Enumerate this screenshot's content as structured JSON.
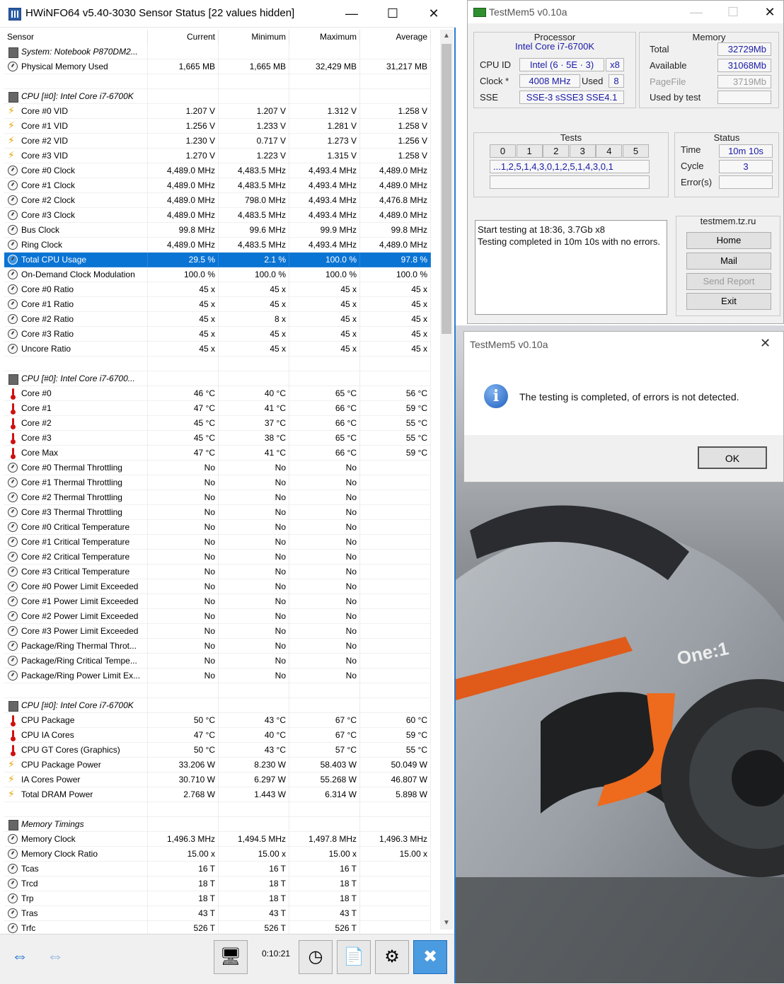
{
  "hwinfo": {
    "title": "HWiNFO64 v5.40-3030 Sensor Status [22 values hidden]",
    "columns": [
      "Sensor",
      "Current",
      "Minimum",
      "Maximum",
      "Average"
    ],
    "rows": [
      {
        "type": "group",
        "icon": "chip",
        "name": "System: Notebook P870DM2...",
        "cur": "",
        "min": "",
        "max": "",
        "avg": ""
      },
      {
        "type": "data",
        "icon": "gauge",
        "name": "Physical Memory Used",
        "cur": "1,665 MB",
        "min": "1,665 MB",
        "max": "32,429 MB",
        "avg": "31,217 MB"
      },
      {
        "type": "blank"
      },
      {
        "type": "group",
        "icon": "chip",
        "name": "CPU [#0]: Intel Core i7-6700K",
        "cur": "",
        "min": "",
        "max": "",
        "avg": ""
      },
      {
        "type": "data",
        "icon": "bolt",
        "name": "Core #0 VID",
        "cur": "1.207 V",
        "min": "1.207 V",
        "max": "1.312 V",
        "avg": "1.258 V"
      },
      {
        "type": "data",
        "icon": "bolt",
        "name": "Core #1 VID",
        "cur": "1.256 V",
        "min": "1.233 V",
        "max": "1.281 V",
        "avg": "1.258 V"
      },
      {
        "type": "data",
        "icon": "bolt",
        "name": "Core #2 VID",
        "cur": "1.230 V",
        "min": "0.717 V",
        "max": "1.273 V",
        "avg": "1.256 V"
      },
      {
        "type": "data",
        "icon": "bolt",
        "name": "Core #3 VID",
        "cur": "1.270 V",
        "min": "1.223 V",
        "max": "1.315 V",
        "avg": "1.258 V"
      },
      {
        "type": "data",
        "icon": "gauge",
        "name": "Core #0 Clock",
        "cur": "4,489.0 MHz",
        "min": "4,483.5 MHz",
        "max": "4,493.4 MHz",
        "avg": "4,489.0 MHz"
      },
      {
        "type": "data",
        "icon": "gauge",
        "name": "Core #1 Clock",
        "cur": "4,489.0 MHz",
        "min": "4,483.5 MHz",
        "max": "4,493.4 MHz",
        "avg": "4,489.0 MHz"
      },
      {
        "type": "data",
        "icon": "gauge",
        "name": "Core #2 Clock",
        "cur": "4,489.0 MHz",
        "min": "798.0 MHz",
        "max": "4,493.4 MHz",
        "avg": "4,476.8 MHz"
      },
      {
        "type": "data",
        "icon": "gauge",
        "name": "Core #3 Clock",
        "cur": "4,489.0 MHz",
        "min": "4,483.5 MHz",
        "max": "4,493.4 MHz",
        "avg": "4,489.0 MHz"
      },
      {
        "type": "data",
        "icon": "gauge",
        "name": "Bus Clock",
        "cur": "99.8 MHz",
        "min": "99.6 MHz",
        "max": "99.9 MHz",
        "avg": "99.8 MHz"
      },
      {
        "type": "data",
        "icon": "gauge",
        "name": "Ring Clock",
        "cur": "4,489.0 MHz",
        "min": "4,483.5 MHz",
        "max": "4,493.4 MHz",
        "avg": "4,489.0 MHz"
      },
      {
        "type": "data",
        "icon": "gauge",
        "name": "Total CPU Usage",
        "cur": "29.5 %",
        "min": "2.1 %",
        "max": "100.0 %",
        "avg": "97.8 %",
        "selected": true
      },
      {
        "type": "data",
        "icon": "gauge",
        "name": "On-Demand Clock Modulation",
        "cur": "100.0 %",
        "min": "100.0 %",
        "max": "100.0 %",
        "avg": "100.0 %"
      },
      {
        "type": "data",
        "icon": "gauge",
        "name": "Core #0 Ratio",
        "cur": "45 x",
        "min": "45 x",
        "max": "45 x",
        "avg": "45 x"
      },
      {
        "type": "data",
        "icon": "gauge",
        "name": "Core #1 Ratio",
        "cur": "45 x",
        "min": "45 x",
        "max": "45 x",
        "avg": "45 x"
      },
      {
        "type": "data",
        "icon": "gauge",
        "name": "Core #2 Ratio",
        "cur": "45 x",
        "min": "8 x",
        "max": "45 x",
        "avg": "45 x"
      },
      {
        "type": "data",
        "icon": "gauge",
        "name": "Core #3 Ratio",
        "cur": "45 x",
        "min": "45 x",
        "max": "45 x",
        "avg": "45 x"
      },
      {
        "type": "data",
        "icon": "gauge",
        "name": "Uncore Ratio",
        "cur": "45 x",
        "min": "45 x",
        "max": "45 x",
        "avg": "45 x"
      },
      {
        "type": "blank"
      },
      {
        "type": "group",
        "icon": "chip",
        "name": "CPU [#0]: Intel Core i7-6700...",
        "cur": "",
        "min": "",
        "max": "",
        "avg": ""
      },
      {
        "type": "data",
        "icon": "therm",
        "name": "Core #0",
        "cur": "46 °C",
        "min": "40 °C",
        "max": "65 °C",
        "avg": "56 °C"
      },
      {
        "type": "data",
        "icon": "therm",
        "name": "Core #1",
        "cur": "47 °C",
        "min": "41 °C",
        "max": "66 °C",
        "avg": "59 °C"
      },
      {
        "type": "data",
        "icon": "therm",
        "name": "Core #2",
        "cur": "45 °C",
        "min": "37 °C",
        "max": "66 °C",
        "avg": "55 °C"
      },
      {
        "type": "data",
        "icon": "therm",
        "name": "Core #3",
        "cur": "45 °C",
        "min": "38 °C",
        "max": "65 °C",
        "avg": "55 °C"
      },
      {
        "type": "data",
        "icon": "therm",
        "name": "Core Max",
        "cur": "47 °C",
        "min": "41 °C",
        "max": "66 °C",
        "avg": "59 °C"
      },
      {
        "type": "data",
        "icon": "gauge",
        "name": "Core #0 Thermal Throttling",
        "cur": "No",
        "min": "No",
        "max": "No",
        "avg": ""
      },
      {
        "type": "data",
        "icon": "gauge",
        "name": "Core #1 Thermal Throttling",
        "cur": "No",
        "min": "No",
        "max": "No",
        "avg": ""
      },
      {
        "type": "data",
        "icon": "gauge",
        "name": "Core #2 Thermal Throttling",
        "cur": "No",
        "min": "No",
        "max": "No",
        "avg": ""
      },
      {
        "type": "data",
        "icon": "gauge",
        "name": "Core #3 Thermal Throttling",
        "cur": "No",
        "min": "No",
        "max": "No",
        "avg": ""
      },
      {
        "type": "data",
        "icon": "gauge",
        "name": "Core #0 Critical Temperature",
        "cur": "No",
        "min": "No",
        "max": "No",
        "avg": ""
      },
      {
        "type": "data",
        "icon": "gauge",
        "name": "Core #1 Critical Temperature",
        "cur": "No",
        "min": "No",
        "max": "No",
        "avg": ""
      },
      {
        "type": "data",
        "icon": "gauge",
        "name": "Core #2 Critical Temperature",
        "cur": "No",
        "min": "No",
        "max": "No",
        "avg": ""
      },
      {
        "type": "data",
        "icon": "gauge",
        "name": "Core #3 Critical Temperature",
        "cur": "No",
        "min": "No",
        "max": "No",
        "avg": ""
      },
      {
        "type": "data",
        "icon": "gauge",
        "name": "Core #0 Power Limit Exceeded",
        "cur": "No",
        "min": "No",
        "max": "No",
        "avg": ""
      },
      {
        "type": "data",
        "icon": "gauge",
        "name": "Core #1 Power Limit Exceeded",
        "cur": "No",
        "min": "No",
        "max": "No",
        "avg": ""
      },
      {
        "type": "data",
        "icon": "gauge",
        "name": "Core #2 Power Limit Exceeded",
        "cur": "No",
        "min": "No",
        "max": "No",
        "avg": ""
      },
      {
        "type": "data",
        "icon": "gauge",
        "name": "Core #3 Power Limit Exceeded",
        "cur": "No",
        "min": "No",
        "max": "No",
        "avg": ""
      },
      {
        "type": "data",
        "icon": "gauge",
        "name": "Package/Ring Thermal Throt...",
        "cur": "No",
        "min": "No",
        "max": "No",
        "avg": ""
      },
      {
        "type": "data",
        "icon": "gauge",
        "name": "Package/Ring Critical Tempe...",
        "cur": "No",
        "min": "No",
        "max": "No",
        "avg": ""
      },
      {
        "type": "data",
        "icon": "gauge",
        "name": "Package/Ring Power Limit Ex...",
        "cur": "No",
        "min": "No",
        "max": "No",
        "avg": ""
      },
      {
        "type": "blank"
      },
      {
        "type": "group",
        "icon": "chip",
        "name": "CPU [#0]: Intel Core i7-6700K",
        "cur": "",
        "min": "",
        "max": "",
        "avg": ""
      },
      {
        "type": "data",
        "icon": "therm",
        "name": "CPU Package",
        "cur": "50 °C",
        "min": "43 °C",
        "max": "67 °C",
        "avg": "60 °C"
      },
      {
        "type": "data",
        "icon": "therm",
        "name": "CPU IA Cores",
        "cur": "47 °C",
        "min": "40 °C",
        "max": "67 °C",
        "avg": "59 °C"
      },
      {
        "type": "data",
        "icon": "therm",
        "name": "CPU GT Cores (Graphics)",
        "cur": "50 °C",
        "min": "43 °C",
        "max": "57 °C",
        "avg": "55 °C"
      },
      {
        "type": "data",
        "icon": "bolt",
        "name": "CPU Package Power",
        "cur": "33.206 W",
        "min": "8.230 W",
        "max": "58.403 W",
        "avg": "50.049 W"
      },
      {
        "type": "data",
        "icon": "bolt",
        "name": "IA Cores Power",
        "cur": "30.710 W",
        "min": "6.297 W",
        "max": "55.268 W",
        "avg": "46.807 W"
      },
      {
        "type": "data",
        "icon": "bolt",
        "name": "Total DRAM Power",
        "cur": "2.768 W",
        "min": "1.443 W",
        "max": "6.314 W",
        "avg": "5.898 W"
      },
      {
        "type": "blank"
      },
      {
        "type": "group",
        "icon": "chip",
        "name": "Memory Timings",
        "cur": "",
        "min": "",
        "max": "",
        "avg": ""
      },
      {
        "type": "data",
        "icon": "gauge",
        "name": "Memory Clock",
        "cur": "1,496.3 MHz",
        "min": "1,494.5 MHz",
        "max": "1,497.8 MHz",
        "avg": "1,496.3 MHz"
      },
      {
        "type": "data",
        "icon": "gauge",
        "name": "Memory Clock Ratio",
        "cur": "15.00 x",
        "min": "15.00 x",
        "max": "15.00 x",
        "avg": "15.00 x"
      },
      {
        "type": "data",
        "icon": "gauge",
        "name": "Tcas",
        "cur": "16 T",
        "min": "16 T",
        "max": "16 T",
        "avg": ""
      },
      {
        "type": "data",
        "icon": "gauge",
        "name": "Trcd",
        "cur": "18 T",
        "min": "18 T",
        "max": "18 T",
        "avg": ""
      },
      {
        "type": "data",
        "icon": "gauge",
        "name": "Trp",
        "cur": "18 T",
        "min": "18 T",
        "max": "18 T",
        "avg": ""
      },
      {
        "type": "data",
        "icon": "gauge",
        "name": "Tras",
        "cur": "43 T",
        "min": "43 T",
        "max": "43 T",
        "avg": ""
      },
      {
        "type": "data",
        "icon": "gauge",
        "name": "Trfc",
        "cur": "526 T",
        "min": "526 T",
        "max": "526 T",
        "avg": ""
      }
    ],
    "toolbar": {
      "elapsed": "0:10:21"
    }
  },
  "testmem": {
    "title": "TestMem5 v0.10a",
    "processor": {
      "heading": "Processor",
      "name": "Intel Core i7-6700K",
      "cpuid_label": "CPU ID",
      "cpuid_value": "Intel  (6 · 5E · 3)",
      "cpuid_threads": "x8",
      "clock_label": "Clock *",
      "clock_value": "4008 MHz",
      "used_label": "Used",
      "used_value": "8",
      "sse_label": "SSE",
      "sse_value": "SSE-3 sSSE3 SSE4.1"
    },
    "memory": {
      "heading": "Memory",
      "total_label": "Total",
      "total_value": "32729Mb",
      "available_label": "Available",
      "available_value": "31068Mb",
      "pagefile_label": "PageFile",
      "pagefile_value": "3719Mb",
      "usedbytest_label": "Used by test",
      "usedbytest_value": ""
    },
    "tests": {
      "heading": "Tests",
      "columns": [
        "0",
        "1",
        "2",
        "3",
        "4",
        "5"
      ],
      "sequence": "...1,2,5,1,4,3,0,1,2,5,1,4,3,0,1"
    },
    "status": {
      "heading": "Status",
      "time_label": "Time",
      "time_value": "10m 10s",
      "cycle_label": "Cycle",
      "cycle_value": "3",
      "errors_label": "Error(s)",
      "errors_value": ""
    },
    "log": [
      "Start testing at 18:36, 3.7Gb x8",
      "Testing completed in 10m 10s with no errors."
    ],
    "site": {
      "heading": "testmem.tz.ru",
      "home": "Home",
      "mail": "Mail",
      "send_report": "Send Report",
      "exit": "Exit"
    }
  },
  "dialog": {
    "title": "TestMem5 v0.10a",
    "message": "The testing is completed, of errors is not detected.",
    "ok": "OK"
  },
  "colors": {
    "selection": "#0a74d4",
    "accent": "#2b7bd4",
    "field_text": "#1a1aa8"
  }
}
